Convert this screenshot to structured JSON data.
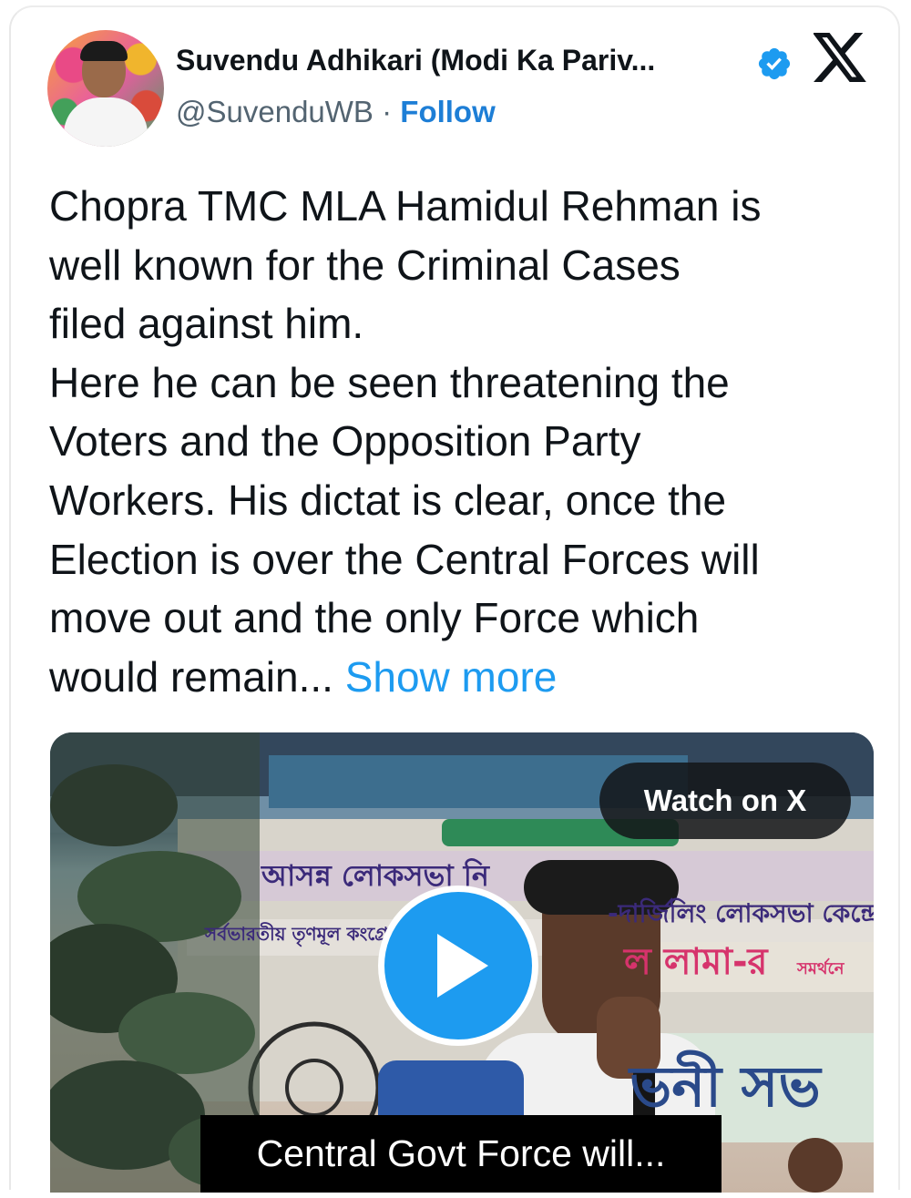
{
  "header": {
    "display_name": "Suvendu Adhikari (Modi Ka Pariv...",
    "handle": "@SuvenduWB",
    "separator": "·",
    "follow_label": "Follow"
  },
  "tweet": {
    "lines": [
      "Chopra TMC MLA Hamidul Rehman is",
      "well known for the Criminal Cases",
      "filed against him.",
      "Here he can be seen threatening the",
      "Voters and the Opposition Party",
      "Workers. His dictat is clear, once the",
      "Election is over the Central Forces will",
      "move out and the only Force which"
    ],
    "last_line": "would remain...",
    "show_more": "Show more"
  },
  "media": {
    "watch_label": "Watch on X",
    "caption": "Central Govt Force will...",
    "banner_texts": [
      "আসন্ন লোকসভা নি",
      "-দার্জিলিং লোকসভা কেন্দ্রে",
      "সর্বভারতীয় তৃণমূল কংগ্রে",
      "ল লামা-র",
      "সমর্থনে",
      "ভনী সভ"
    ]
  },
  "colors": {
    "link": "#1d9bf0",
    "follow": "#1d7ed6",
    "verified": "#1d9bf0",
    "text": "#0f1419",
    "muted": "#536471"
  },
  "icons": [
    "verified-badge-icon",
    "x-logo-icon",
    "play-icon"
  ]
}
